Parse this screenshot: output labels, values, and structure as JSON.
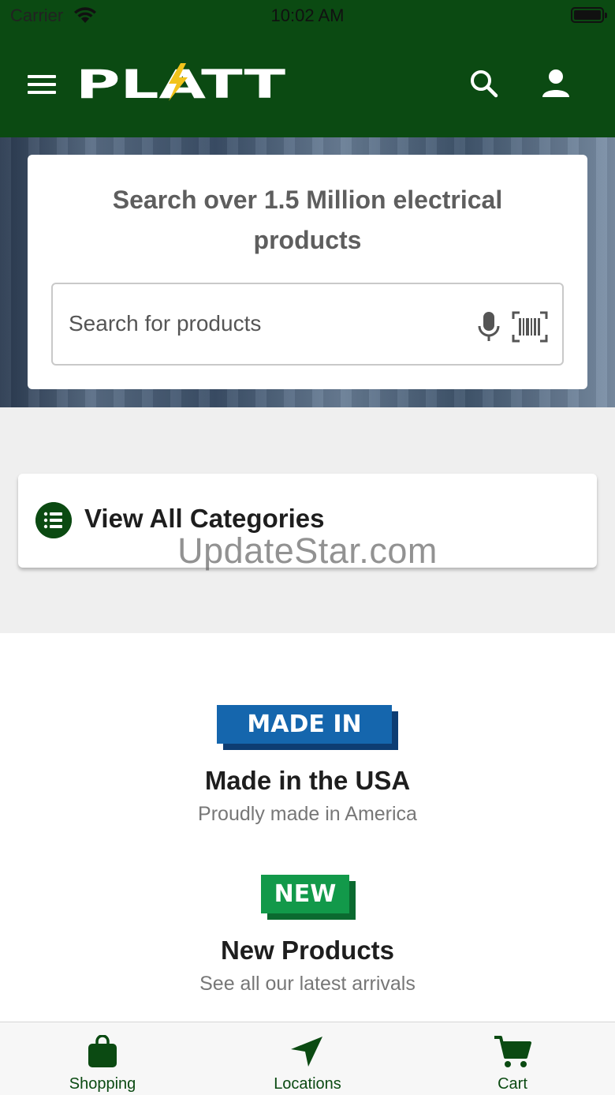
{
  "status_bar": {
    "carrier": "Carrier",
    "time": "10:02 AM"
  },
  "header": {
    "logo_text": "PLATT",
    "brand_color": "#0b4a12",
    "accent_color": "#f2c31b"
  },
  "hero": {
    "title": "Search over 1.5 Million electrical products",
    "search_placeholder": "Search for products"
  },
  "categories": {
    "label": "View All Categories"
  },
  "watermark": "UpdateStar.com",
  "features": [
    {
      "badge": "MADE IN USA",
      "title": "Made in the USA",
      "subtitle": "Proudly made in America",
      "badge_color": "#1566ad"
    },
    {
      "badge": "NEW",
      "title": "New Products",
      "subtitle": "See all our latest arrivals",
      "badge_color": "#12994a"
    }
  ],
  "tabs": [
    {
      "label": "Shopping",
      "icon": "shopping-bag-icon"
    },
    {
      "label": "Locations",
      "icon": "location-arrow-icon"
    },
    {
      "label": "Cart",
      "icon": "cart-icon"
    }
  ]
}
